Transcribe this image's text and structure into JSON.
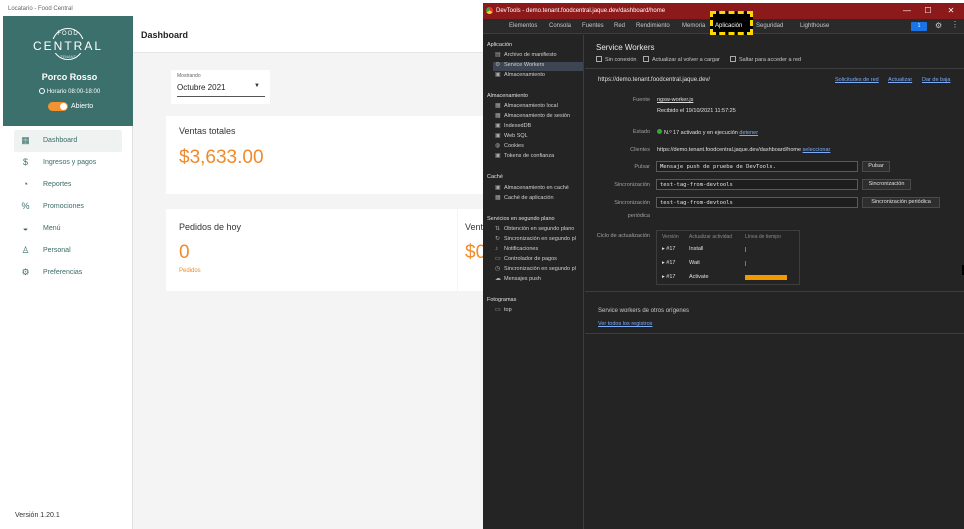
{
  "app": {
    "window_title": "Locatario - Food Central",
    "brand": {
      "food": "FOOD",
      "central": "CENTRAL",
      "sub": "TENANT"
    },
    "username": "Porco Rosso",
    "schedule": "Horario 08:00-18:00",
    "open_label": "Abierto",
    "nav": [
      {
        "label": "Dashboard",
        "icon": "dashboard-icon"
      },
      {
        "label": "Ingresos y pagos",
        "icon": "dollar-icon"
      },
      {
        "label": "Reportes",
        "icon": "reports-icon"
      },
      {
        "label": "Promociones",
        "icon": "percent-icon"
      },
      {
        "label": "Menú",
        "icon": "dish-icon"
      },
      {
        "label": "Personal",
        "icon": "person-icon"
      },
      {
        "label": "Preferencias",
        "icon": "gear-icon"
      }
    ],
    "version": "Versión 1.20.1",
    "page_title": "Dashboard",
    "month_select": {
      "label": "Mostrando",
      "value": "Octubre 2021"
    },
    "sales": {
      "title": "Ventas totales",
      "value": "$3,633.00"
    },
    "orders": {
      "title": "Pedidos de hoy",
      "value": "0",
      "sub": "Pedidos"
    },
    "sales_today_partial": {
      "title": "Vent",
      "value": "$0"
    },
    "accent_color": "#f08a2b",
    "brand_color": "#3b706c"
  },
  "devtools": {
    "title": "DevTools - demo.tenant.foodcentral.jaque.dev/dashboard/home",
    "tabs": [
      "Elementos",
      "Consola",
      "Fuentes",
      "Red",
      "Rendimiento",
      "Memoria",
      "Aplicación",
      "Seguridad",
      "Lighthouse"
    ],
    "badge": "1",
    "sidebar": {
      "app_section": "Aplicación",
      "app_items": [
        "Archivo de manifiesto",
        "Service Workers",
        "Almacenamiento"
      ],
      "storage_section": "Almacenamiento",
      "storage_items": [
        "Almacenamiento local",
        "Almacenamiento de sesión",
        "IndexedDB",
        "Web SQL",
        "Cookies",
        "Tokens de confianza"
      ],
      "cache_section": "Caché",
      "cache_items": [
        "Almacenamiento en caché",
        "Caché de aplicación"
      ],
      "bg_section": "Servicios en segundo plano",
      "bg_items": [
        "Obtención en segundo plano",
        "Sincronización en segundo pl",
        "Notificaciones",
        "Controlador de pagos",
        "Sincronización en segundo pl",
        "Mensajes push"
      ],
      "frames_section": "Fotogramas",
      "frames_items": [
        "top"
      ]
    },
    "main": {
      "heading": "Service Workers",
      "options": [
        "Sin conexión",
        "Actualizar al volver a cargar",
        "Saltar para acceder a red"
      ],
      "origin": "https://demo.tenant.foodcentral.jaque.dev/",
      "origin_links": [
        "Solicitudes de red",
        "Actualizar",
        "Dar de baja"
      ],
      "source_label": "Fuente",
      "source_file": "ngsw-worker.js",
      "received": "Recibido el 19/10/2021 11:57:25",
      "status_label": "Estado",
      "status_text": "N.º 17 activado y en ejecución",
      "stop_link": "detener",
      "clients_label": "Clientes",
      "clients_url": "https://demo.tenant.foodcentral.jaque.dev/dashboard/home",
      "select_link": "seleccionar",
      "push_label": "Pulsar",
      "push_value": "Mensaje push de prueba de DevTools.",
      "push_button": "Pulsar",
      "sync_label": "Sincronización",
      "sync_value": "test-tag-from-devtools",
      "sync_button": "Sincronización",
      "periodic_label_1": "Sincronización",
      "periodic_label_2": "periódica",
      "periodic_value": "test-tag-from-devtools",
      "periodic_button": "Sincronización periódica",
      "cycle_label": "Ciclo de actualización",
      "cycle_headers": [
        "Versión",
        "Actualizar actividad",
        "Línea de tiempo"
      ],
      "cycle_rows": [
        {
          "version": "#17",
          "activity": "Install"
        },
        {
          "version": "#17",
          "activity": "Wait"
        },
        {
          "version": "#17",
          "activity": "Activate"
        }
      ],
      "other_heading": "Service workers de otros orígenes",
      "see_all": "Ver todos los registros"
    }
  }
}
